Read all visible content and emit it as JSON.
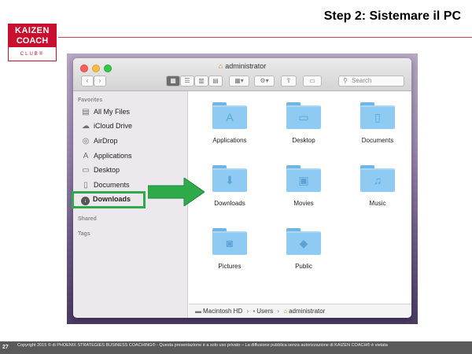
{
  "slide": {
    "title": "Step 2: Sistemare il PC",
    "logo": {
      "line1": "KAIZEN",
      "line2": "COACH",
      "line3": "CLUB®"
    },
    "page_number": "27",
    "copyright": "Copyright 2015 © di PHOENIX STRATEGIES BUSINESS COACHING® - Questa presentazione è a solo uso privato – La diffusione pubblica senza autorizzazione di KAIZEN COACH® è vietata"
  },
  "window": {
    "title": "administrator",
    "search_placeholder": "Search"
  },
  "sidebar": {
    "favorites_header": "Favorites",
    "items": [
      {
        "label": "All My Files",
        "icon": "all-files-icon"
      },
      {
        "label": "iCloud Drive",
        "icon": "cloud-icon"
      },
      {
        "label": "AirDrop",
        "icon": "airdrop-icon"
      },
      {
        "label": "Applications",
        "icon": "applications-icon"
      },
      {
        "label": "Desktop",
        "icon": "desktop-icon"
      },
      {
        "label": "Documents",
        "icon": "documents-icon"
      },
      {
        "label": "Downloads",
        "icon": "downloads-icon"
      }
    ],
    "shared_header": "Shared",
    "tags_header": "Tags"
  },
  "folders": [
    {
      "label": "Applications",
      "icon": "applications-icon"
    },
    {
      "label": "Desktop",
      "icon": "desktop-icon"
    },
    {
      "label": "Documents",
      "icon": "documents-icon"
    },
    {
      "label": "Downloads",
      "icon": "downloads-icon"
    },
    {
      "label": "Movies",
      "icon": "movies-icon"
    },
    {
      "label": "Music",
      "icon": "music-icon"
    },
    {
      "label": "Pictures",
      "icon": "pictures-icon"
    },
    {
      "label": "Public",
      "icon": "public-icon"
    }
  ],
  "pathbar": {
    "drive": "Macintosh HD",
    "folder": "Users",
    "user": "administrator"
  },
  "colors": {
    "brand_red": "#c8102e",
    "highlight_green": "#2eaa4a",
    "folder_blue": "#8fcaf3"
  }
}
